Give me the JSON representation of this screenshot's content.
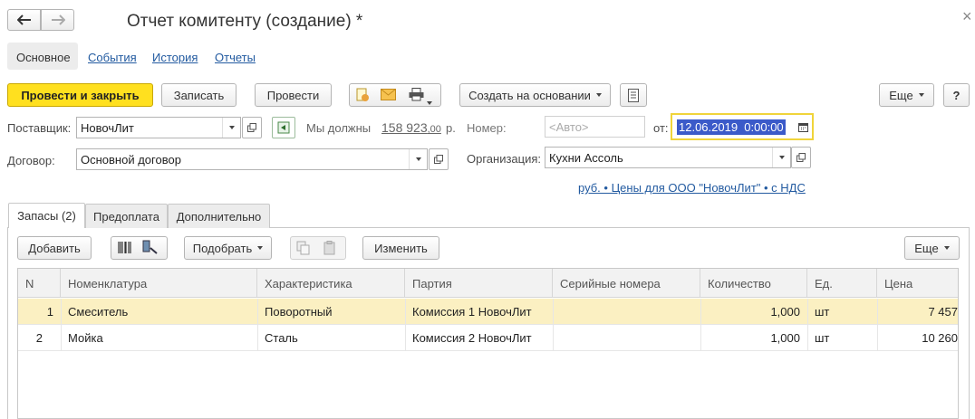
{
  "window": {
    "title": "Отчет комитенту (создание) *",
    "close_glyph": "×"
  },
  "nav": {
    "back": "🡐",
    "forward": "🡒"
  },
  "top_tabs": [
    "Основное",
    "События",
    "История",
    "Отчеты"
  ],
  "toolbar": {
    "post_close": "Провести и закрыть",
    "save": "Записать",
    "post": "Провести",
    "create_based": "Создать на основании",
    "more": "Еще",
    "help": "?"
  },
  "form": {
    "supplier_label": "Поставщик:",
    "supplier_value": "НовочЛит",
    "owe_text": "Мы должны",
    "owe_amount": "158 923",
    "owe_cents": ",00",
    "owe_currency": "р.",
    "number_label": "Номер:",
    "number_placeholder": "<Авто>",
    "from_label": "от:",
    "date_value": "12.06.2019  0:00:00",
    "contract_label": "Договор:",
    "contract_value": "Основной договор",
    "org_label": "Организация:",
    "org_value": "Кухни Ассоль",
    "price_link": "руб. • Цены для ООО \"НовочЛит\" • с НДС"
  },
  "sub_tabs": [
    "Запасы (2)",
    "Предоплата",
    "Дополнительно"
  ],
  "grid_toolbar": {
    "add": "Добавить",
    "select": "Подобрать",
    "change": "Изменить",
    "more": "Еще"
  },
  "table": {
    "columns": [
      "N",
      "Номенклатура",
      "Характеристика",
      "Партия",
      "Серийные номера",
      "Количество",
      "Ед.",
      "Цена"
    ],
    "rows": [
      {
        "n": "1",
        "item": "Смеситель",
        "char": "Поворотный",
        "batch": "Комиссия 1 НовочЛит",
        "serial": "",
        "qty": "1,000",
        "unit": "шт",
        "price": "7 457"
      },
      {
        "n": "2",
        "item": "Мойка",
        "char": "Сталь",
        "batch": "Комиссия 2 НовочЛит",
        "serial": "",
        "qty": "1,000",
        "unit": "шт",
        "price": "10 260"
      }
    ]
  },
  "colors": {
    "primary": "#ffe01f",
    "selected_row": "#fbf0c2",
    "link": "#225aa0",
    "date_highlight": "#3b5ac9"
  }
}
